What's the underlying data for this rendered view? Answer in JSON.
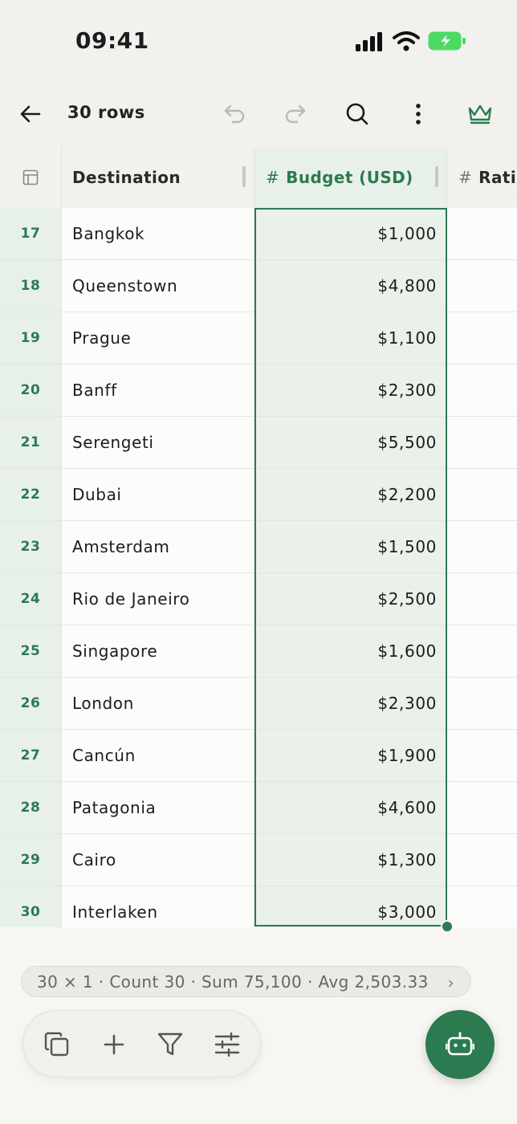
{
  "status": {
    "time": "09:41"
  },
  "toolbar": {
    "row_count": "30 rows",
    "icons": [
      "back-arrow-icon",
      "undo-icon",
      "redo-icon",
      "search-icon",
      "more-vertical-icon",
      "crown-icon"
    ]
  },
  "columns": {
    "corner_icon": "table-icon",
    "destination": "Destination",
    "budget": "Budget (USD)",
    "rating": "Ratin",
    "hash": "#"
  },
  "rows": [
    {
      "num": "17",
      "destination": "Bangkok",
      "budget": "$1,000"
    },
    {
      "num": "18",
      "destination": "Queenstown",
      "budget": "$4,800"
    },
    {
      "num": "19",
      "destination": "Prague",
      "budget": "$1,100"
    },
    {
      "num": "20",
      "destination": "Banff",
      "budget": "$2,300"
    },
    {
      "num": "21",
      "destination": "Serengeti",
      "budget": "$5,500"
    },
    {
      "num": "22",
      "destination": "Dubai",
      "budget": "$2,200"
    },
    {
      "num": "23",
      "destination": "Amsterdam",
      "budget": "$1,500"
    },
    {
      "num": "24",
      "destination": "Rio de Janeiro",
      "budget": "$2,500"
    },
    {
      "num": "25",
      "destination": "Singapore",
      "budget": "$1,600"
    },
    {
      "num": "26",
      "destination": "London",
      "budget": "$2,300"
    },
    {
      "num": "27",
      "destination": "Cancún",
      "budget": "$1,900"
    },
    {
      "num": "28",
      "destination": "Patagonia",
      "budget": "$4,600"
    },
    {
      "num": "29",
      "destination": "Cairo",
      "budget": "$1,300"
    },
    {
      "num": "30",
      "destination": "Interlaken",
      "budget": "$3,000"
    }
  ],
  "summary": {
    "text": "30 × 1 · Count 30 · Sum 75,100 · Avg 2,503.33",
    "chevron": "›"
  },
  "bottom_toolbar": {
    "icons": [
      "copy-icon",
      "add-icon",
      "filter-icon",
      "adjust-icon"
    ]
  },
  "fab": {
    "icon": "bot-icon"
  },
  "colors": {
    "accent": "#2c7a50",
    "selection_bg": "#e8f1e9",
    "background": "#f7f6f2"
  }
}
